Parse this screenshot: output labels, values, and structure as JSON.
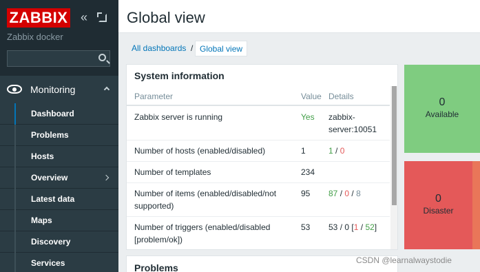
{
  "sidebar": {
    "logo": "ZABBIX",
    "subtitle": "Zabbix docker",
    "search_placeholder": "",
    "section_label": "Monitoring",
    "items": [
      {
        "label": "Dashboard"
      },
      {
        "label": "Problems"
      },
      {
        "label": "Hosts"
      },
      {
        "label": "Overview"
      },
      {
        "label": "Latest data"
      },
      {
        "label": "Maps"
      },
      {
        "label": "Discovery"
      },
      {
        "label": "Services"
      }
    ]
  },
  "header": {
    "title": "Global view"
  },
  "breadcrumb": {
    "link": "All dashboards",
    "separator": "/",
    "current": "Global view"
  },
  "system_info": {
    "title": "System information",
    "columns": [
      "Parameter",
      "Value",
      "Details"
    ],
    "rows": [
      {
        "param": "Zabbix server is running",
        "value": "Yes",
        "details": "zabbix-server:10051"
      },
      {
        "param": "Number of hosts (enabled/disabled)",
        "value": "1",
        "d1": "1",
        "d2": "0"
      },
      {
        "param": "Number of templates",
        "value": "234"
      },
      {
        "param": "Number of items (enabled/disabled/not supported)",
        "value": "95",
        "d1": "87",
        "d2": "0",
        "d3": "8"
      },
      {
        "param": "Number of triggers (enabled/disabled [problem/ok])",
        "value": "53",
        "d1": "53",
        "d2": "0",
        "d3": "1",
        "d4": "52"
      }
    ]
  },
  "problems_widget": {
    "title": "Problems"
  },
  "tiles": {
    "available": {
      "count": "0",
      "label": "Available",
      "color": "#7fcc80"
    },
    "disaster": {
      "count": "0",
      "label": "Disaster",
      "color": "#e45959"
    },
    "high": {
      "color": "#e97659"
    }
  },
  "watermark": "CSDN @learnalwaystodie"
}
